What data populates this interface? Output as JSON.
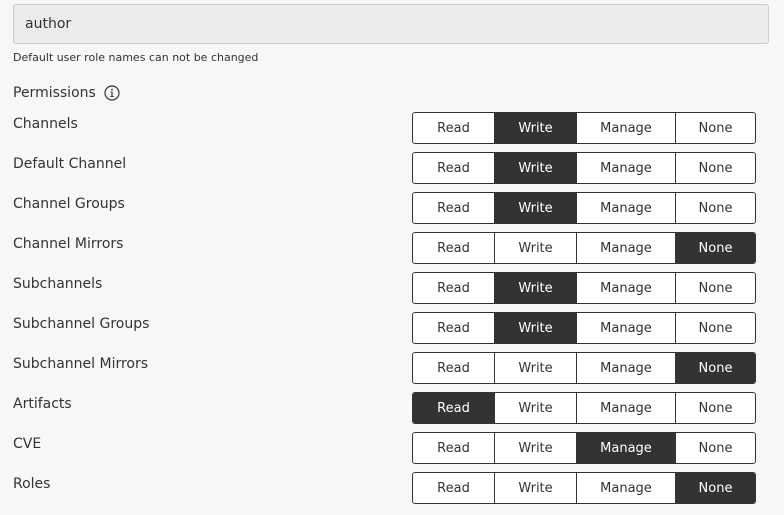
{
  "role_name": {
    "value": "author",
    "help": "Default user role names can not be changed"
  },
  "permissions_heading": "Permissions",
  "options": [
    "Read",
    "Write",
    "Manage",
    "None"
  ],
  "rows": [
    {
      "label": "Channels",
      "selected": "Write"
    },
    {
      "label": "Default Channel",
      "selected": "Write"
    },
    {
      "label": "Channel Groups",
      "selected": "Write"
    },
    {
      "label": "Channel Mirrors",
      "selected": "None"
    },
    {
      "label": "Subchannels",
      "selected": "Write"
    },
    {
      "label": "Subchannel Groups",
      "selected": "Write"
    },
    {
      "label": "Subchannel Mirrors",
      "selected": "None"
    },
    {
      "label": "Artifacts",
      "selected": "Read"
    },
    {
      "label": "CVE",
      "selected": "Manage"
    },
    {
      "label": "Roles",
      "selected": "None"
    }
  ],
  "colors": {
    "active_bg": "#333333",
    "active_text": "#ffffff",
    "input_bg": "#e9ebed",
    "page_bg": "#f7f7f7"
  }
}
